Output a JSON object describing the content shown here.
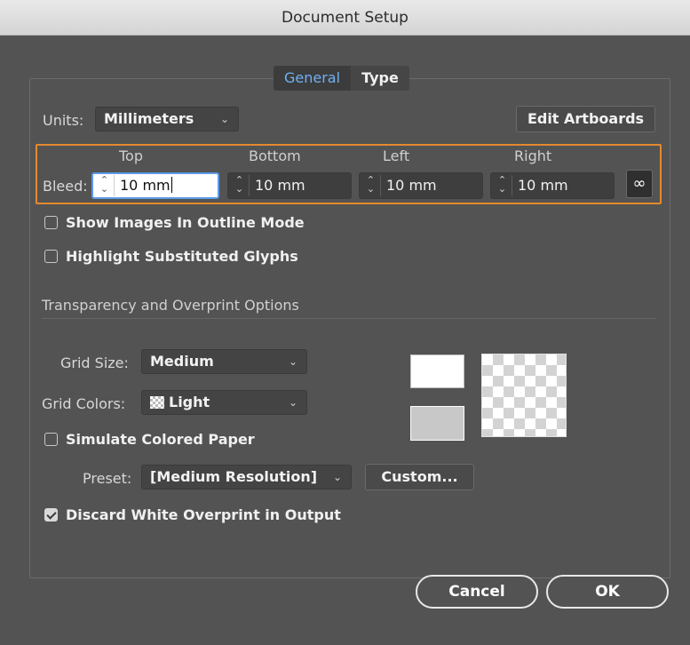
{
  "window": {
    "title": "Document Setup"
  },
  "tabs": [
    {
      "label": "General",
      "active": true
    },
    {
      "label": "Type",
      "active": false
    }
  ],
  "units": {
    "label": "Units:",
    "value": "Millimeters"
  },
  "edit_artboards_label": "Edit Artboards",
  "bleed": {
    "label": "Bleed:",
    "columns": [
      {
        "header": "Top",
        "value": "10 mm"
      },
      {
        "header": "Bottom",
        "value": "10 mm"
      },
      {
        "header": "Left",
        "value": "10 mm"
      },
      {
        "header": "Right",
        "value": "10 mm"
      }
    ],
    "link_icon": "link-chain-icon"
  },
  "checkboxes": {
    "show_images_outline": {
      "label": "Show Images In Outline Mode",
      "checked": false
    },
    "highlight_glyphs": {
      "label": "Highlight Substituted Glyphs",
      "checked": false
    },
    "simulate_paper": {
      "label": "Simulate Colored Paper",
      "checked": false
    },
    "discard_white": {
      "label": "Discard White Overprint in Output",
      "checked": true
    }
  },
  "transparency": {
    "title": "Transparency and Overprint Options",
    "grid_size": {
      "label": "Grid Size:",
      "value": "Medium"
    },
    "grid_colors": {
      "label": "Grid Colors:",
      "value": "Light"
    },
    "preset": {
      "label": "Preset:",
      "value": "[Medium Resolution]"
    },
    "custom_label": "Custom..."
  },
  "footer": {
    "cancel_label": "Cancel",
    "ok_label": "OK"
  },
  "colors": {
    "dialog_bg": "#535353",
    "accent_orange": "#e48a2e",
    "tab_active_text": "#6fb0f2",
    "focus_blue": "#5b9ae8"
  }
}
